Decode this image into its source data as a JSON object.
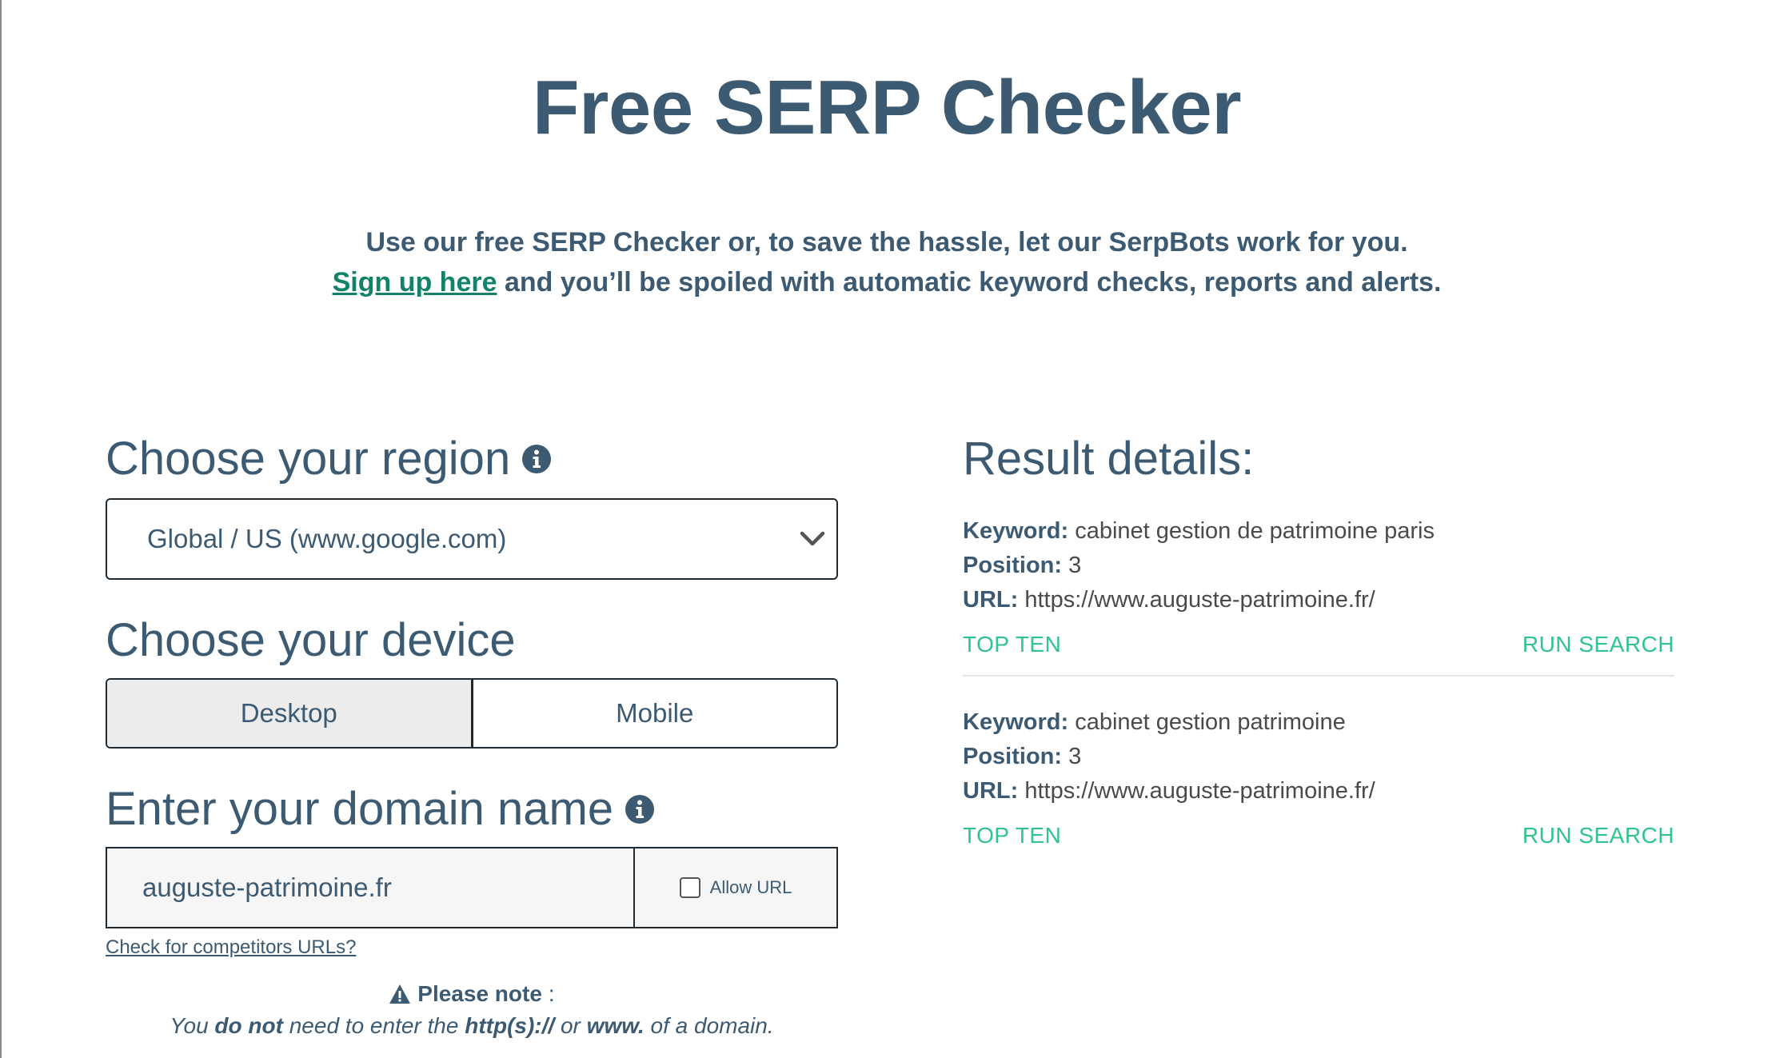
{
  "title": "Free SERP Checker",
  "intro": {
    "line1": "Use our free SERP Checker or, to save the hassle, let our SerpBots work for you.",
    "signup_link": "Sign up here",
    "line2_rest": " and you’ll be spoiled with automatic keyword checks, reports and alerts."
  },
  "region": {
    "heading": "Choose your region",
    "selected": "Global / US (www.google.com)"
  },
  "device": {
    "heading": "Choose your device",
    "options": [
      "Desktop",
      "Mobile"
    ],
    "selected": "Desktop"
  },
  "domain": {
    "heading": "Enter your domain name",
    "value": "auguste-patrimoine.fr",
    "allow_url_label": "Allow URL",
    "competitors_link": "Check for competitors URLs?"
  },
  "note": {
    "title": "Please note",
    "colon": ":",
    "t1": "You ",
    "b1": "do not",
    "t2": " need to enter the ",
    "b2": "http(s)://",
    "t3": " or ",
    "b3": "www.",
    "t4": " of a domain."
  },
  "results": {
    "heading": "Result details:",
    "labels": {
      "keyword": "Keyword:",
      "position": "Position:",
      "url": "URL:"
    },
    "items": [
      {
        "keyword": "cabinet gestion de patrimoine paris",
        "position": "3",
        "url": "https://www.auguste-patrimoine.fr/",
        "top_ten": "TOP TEN",
        "run_search": "RUN SEARCH"
      },
      {
        "keyword": "cabinet gestion patrimoine",
        "position": "3",
        "url": "https://www.auguste-patrimoine.fr/",
        "top_ten": "TOP TEN",
        "run_search": "RUN SEARCH"
      }
    ]
  },
  "colors": {
    "heading": "#3d5a73",
    "link": "#12836a",
    "action": "#2ec48c"
  },
  "icons": [
    "info-icon",
    "chevron-down-icon",
    "warning-icon"
  ]
}
